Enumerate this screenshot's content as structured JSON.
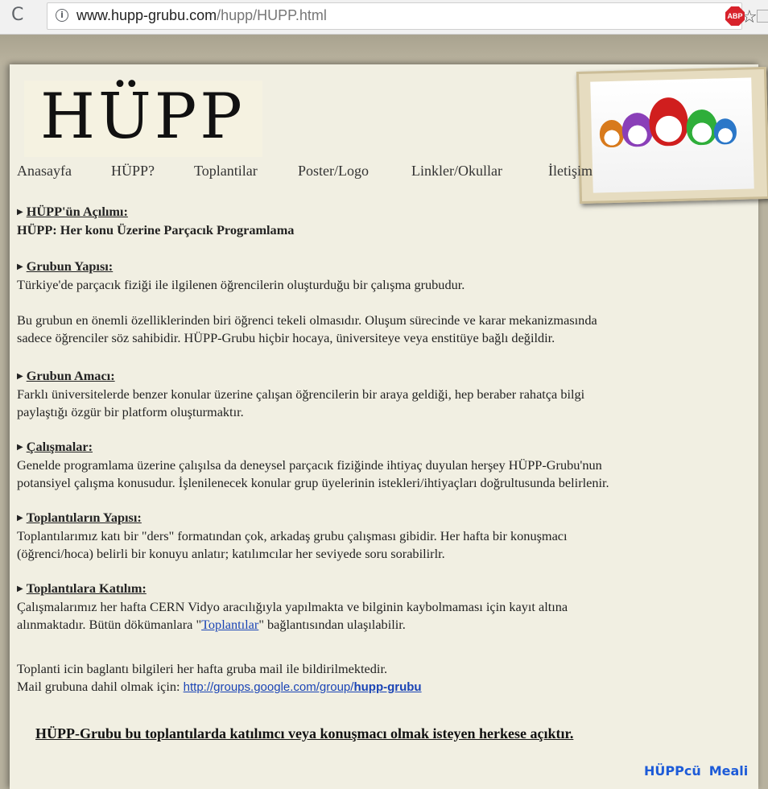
{
  "browser": {
    "url_host": "www.hupp-grubu.com",
    "url_path": "/hupp/HUPP.html",
    "abp_label": "ABP",
    "reload_icon": "reload-icon",
    "star_icon": "star-icon"
  },
  "logo": {
    "text": "HÜPP"
  },
  "nav": [
    "Anasayfa",
    "HÜPP?",
    "Toplantilar",
    "Poster/Logo",
    "Linkler/Okullar",
    "İletişim"
  ],
  "sections": {
    "s1_title": "HÜPP'ün Açılımı:",
    "s1_line": "HÜPP: Her konu Üzerine Parçacık Programlama",
    "s2_title": "Grubun Yapısı:",
    "s2_p1": "Türkiye'de parçacık fiziği ile ilgilenen öğrencilerin oluşturduğu bir çalışma grubudur.",
    "s2_p2a": "Bu grubun en önemli özelliklerinden biri öğrenci tekeli olmasıdır. Oluşum sürecinde ve karar mekanizmasında",
    "s2_p2b": "sadece öğrenciler söz sahibidir. HÜPP-Grubu hiçbir hocaya, üniversiteye veya enstitüye bağlı değildir.",
    "s3_title": "Grubun Amacı:",
    "s3_a": "Farklı üniversitelerde benzer konular üzerine çalışan öğrencilerin bir araya geldiği, hep beraber rahatça bilgi",
    "s3_b": "paylaştığı özgür bir platform oluşturmaktır.",
    "s4_title": "Çalışmalar:",
    "s4_a": "Genelde programlama üzerine çalışılsa da deneysel parçacık fiziğinde ihtiyaç duyulan herşey HÜPP-Grubu'nun",
    "s4_b": "potansiyel çalışma konusudur. İşlenilenecek konular grup üyelerinin istekleri/ihtiyaçları doğrultusunda belirlenir.",
    "s5_title": "Toplantıların Yapısı:",
    "s5_a": "Toplantılarımız katı bir \"ders\" formatından çok, arkadaş grubu çalışması gibidir. Her hafta bir konuşmacı",
    "s5_b": "(öğrenci/hoca) belirli bir konuyu anlatır; katılımcılar her seviyede soru sorabilirlr.",
    "s6_title": "Toplantılara Katılım:",
    "s6_a": "Çalışmalarımız her hafta CERN Vidyo aracılığıyla yapılmakta ve bilginin kaybolmaması için kayıt altına",
    "s6_b_pre": "alınmaktadır. Bütün dökümanlara \"",
    "s6_b_link": "Toplantılar",
    "s6_b_post": "\" bağlantısından ulaşılabilir.",
    "s7_a": "Toplanti icin baglantı bilgileri her hafta gruba mail ile bildirilmektedir.",
    "s7_b_pre": "Mail grubuna dahil olmak için: ",
    "s7_link_plain": "http://groups.google.com/group/",
    "s7_link_bold": "hupp-grubu"
  },
  "footer_note": "HÜPP-Grubu bu toplantılarda katılımcı veya konuşmacı olmak isteyen herkese açıktır.",
  "corner_links": [
    "HÜPPcü",
    "Meali"
  ]
}
